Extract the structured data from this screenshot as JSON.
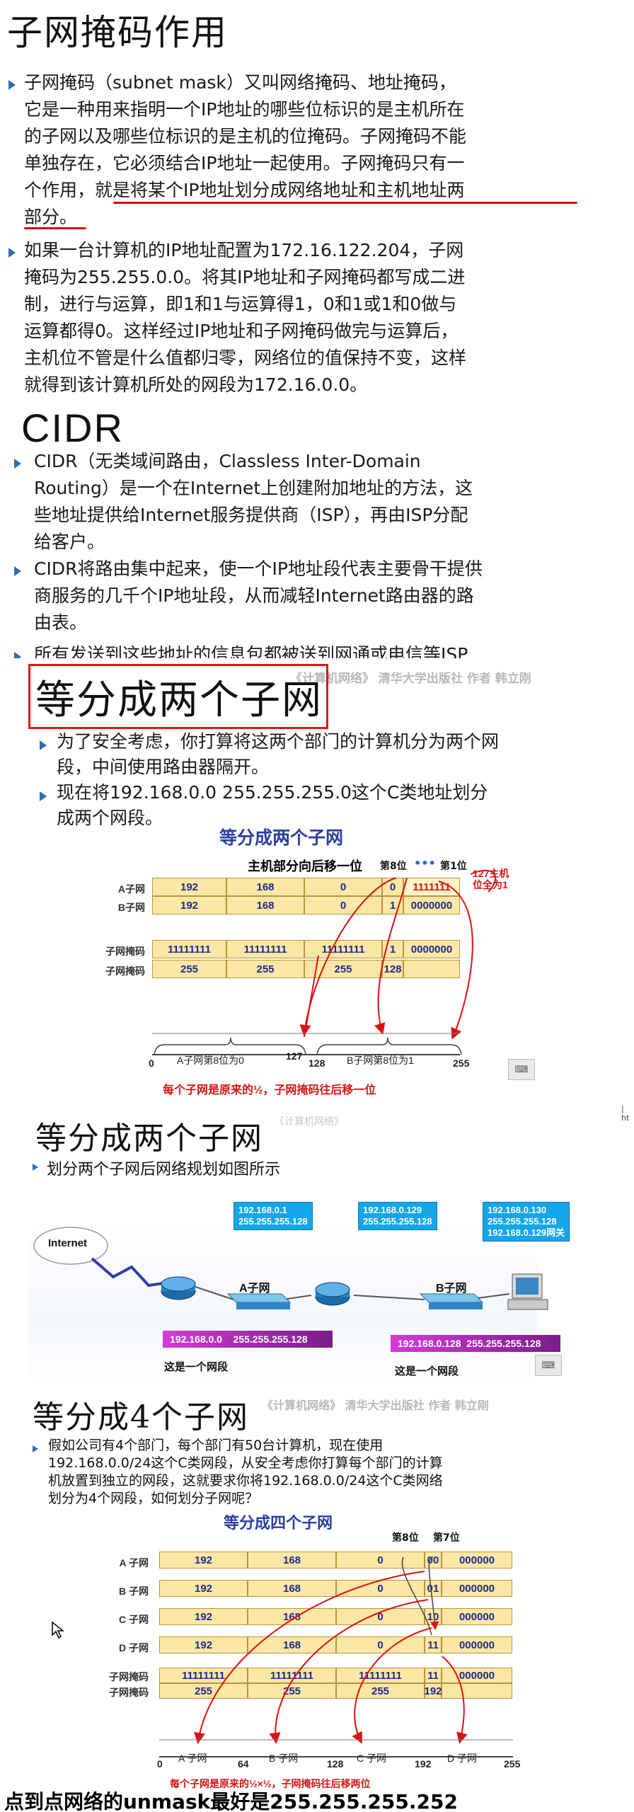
{
  "section1": {
    "title": "子网掩码作用",
    "p1_lines": [
      "子网掩码（subnet mask）又叫网络掩码、地址掩码，",
      "它是一种用来指明一个IP地址的哪些位标识的是主机所在",
      "的子网以及哪些位标识的是主机的位掩码。子网掩码不能",
      "单独存在，它必须结合IP地址一起使用。子网掩码只有一",
      "个作用，就是将某个IP地址划分成网络地址和主机地址两",
      "部分。"
    ],
    "p2_lines": [
      "如果一台计算机的IP地址配置为172.16.122.204，子网",
      "掩码为255.255.0.0。将其IP地址和子网掩码都写成二进",
      "制，进行与运算，即1和1与运算得1，0和1或1和0做与",
      "运算都得0。这样经过IP地址和子网掩码做完与运算后，",
      "主机位不管是什么值都归零，网络位的值保持不变，这样",
      "就得到该计算机所处的网段为172.16.0.0。"
    ]
  },
  "section2": {
    "title": "CIDR",
    "p1_lines": [
      "CIDR（无类域间路由，Classless Inter-Domain",
      "Routing）是一个在Internet上创建附加地址的方法，这",
      "些地址提供给Internet服务提供商（ISP），再由ISP分配",
      "给客户。"
    ],
    "p2_lines": [
      "CIDR将路由集中起来，使一个IP地址段代表主要骨干提供",
      "商服务的几千个IP地址段，从而减轻Internet路由器的路",
      "由表。"
    ],
    "p3_cut": "所有发送到这些地址的信息包都被送到网通或电信等ISP",
    "watermark": "《计算机网络》 清华大学出版社 作者 韩立刚"
  },
  "section3": {
    "title": "等分成两个子网",
    "p1_lines": [
      "为了安全考虑，你打算将这两个部门的计算机分为两个网",
      "段，中间使用路由器隔开。"
    ],
    "p2_lines": [
      "现在将192.168.0.0 255.255.255.0这个C类地址划分",
      "成两个网段。"
    ],
    "diagram": {
      "title": "等分成两个子网",
      "note_top": "主机部分向后移一位",
      "bit8": "第8位",
      "dots": "•••",
      "bit1": "第1位",
      "red_note": "127主机位全为1",
      "rows": [
        {
          "label": "A子网",
          "cells": [
            "192",
            "168",
            "0",
            "0",
            "1111111"
          ]
        },
        {
          "label": "B子网",
          "cells": [
            "192",
            "168",
            "0",
            "1",
            "0000000"
          ]
        },
        {
          "label": "子网掩码",
          "cells": [
            "11111111",
            "11111111",
            "11111111",
            "1",
            "0000000"
          ]
        },
        {
          "label": "子网掩码",
          "cells": [
            "255",
            "255",
            "255",
            "128",
            ""
          ]
        }
      ],
      "axis": [
        "0",
        "127",
        "128",
        "255"
      ],
      "seg_a": "A子网第8位为0",
      "seg_b": "B子网第8位为1",
      "bottom_note": "每个子网是原来的½，子网掩码往后移一位",
      "kb": "⌨",
      "side": "| ht"
    }
  },
  "section4": {
    "title": "等分成两个子网",
    "faded": "《计算机网络》",
    "p1": "划分两个子网后网络规划如图所示",
    "internet": "Internet",
    "r1_ip": "192.168.0.1",
    "r1_mask": "255.255.255.128",
    "r2_ip": "192.168.0.129",
    "r2_mask": "255.255.255.128",
    "pc_ip": "192.168.0.130",
    "pc_mask": "255.255.255.128",
    "pc_gw": "192.168.0.129网关",
    "sub_a": "A子网",
    "sub_b": "B子网",
    "net_a": "192.168.0.0    255.255.255.128",
    "net_b": "192.168.0.128  255.255.255.128",
    "label_a": "这是一个网段",
    "label_b": "这是一个网段"
  },
  "section5": {
    "title": "等分成4个子网",
    "watermark": "《计算机网络》 清华大学出版社 作者 韩立刚",
    "p1_lines": [
      "假如公司有4个部门，每个部门有50台计算机，现在使用",
      "192.168.0.0/24这个C类网段，从安全考虑你打算每个部门的计算",
      "机放置到独立的网段，这就要求你将192.168.0.0/24这个C类网络",
      "划分为4个网段，如何划分子网呢？"
    ],
    "diagram": {
      "title": "等分成四个子网",
      "bit8": "第8位",
      "bit7": "第7位",
      "rows": [
        {
          "label": "A 子网",
          "cells": [
            "192",
            "168",
            "0",
            "00",
            "000000"
          ]
        },
        {
          "label": "B 子网",
          "cells": [
            "192",
            "168",
            "0",
            "01",
            "000000"
          ]
        },
        {
          "label": "C 子网",
          "cells": [
            "192",
            "168",
            "0",
            "10",
            "000000"
          ]
        },
        {
          "label": "D 子网",
          "cells": [
            "192",
            "168",
            "0",
            "11",
            "000000"
          ]
        }
      ],
      "mask_labels": [
        "子网掩码",
        "子网掩码"
      ],
      "mask_bin": [
        "11111111",
        "11111111",
        "11111111",
        "11",
        "000000"
      ],
      "mask_dec": [
        "255",
        "255",
        "255",
        "192",
        ""
      ],
      "axis": [
        "0",
        "64",
        "128",
        "192",
        "255"
      ],
      "segs": [
        "A 子网",
        "B 子网",
        "C 子网",
        "D 子网"
      ],
      "bottom_note": "每个子网是原来的½×½，子网掩码往后移两位"
    }
  },
  "footer": "点到点网络的unmask最好是255.255.255.252"
}
